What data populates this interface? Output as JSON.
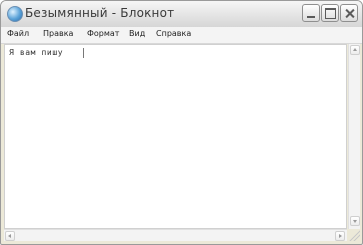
{
  "window": {
    "title": "Безымянный - Блокнот",
    "icon": "notepad-icon"
  },
  "menu": [
    {
      "label": "Файл"
    },
    {
      "label": "Правка"
    },
    {
      "label": "Формат"
    },
    {
      "label": "Вид"
    },
    {
      "label": "Справка"
    }
  ],
  "editor": {
    "text": "Я вам пишу"
  }
}
